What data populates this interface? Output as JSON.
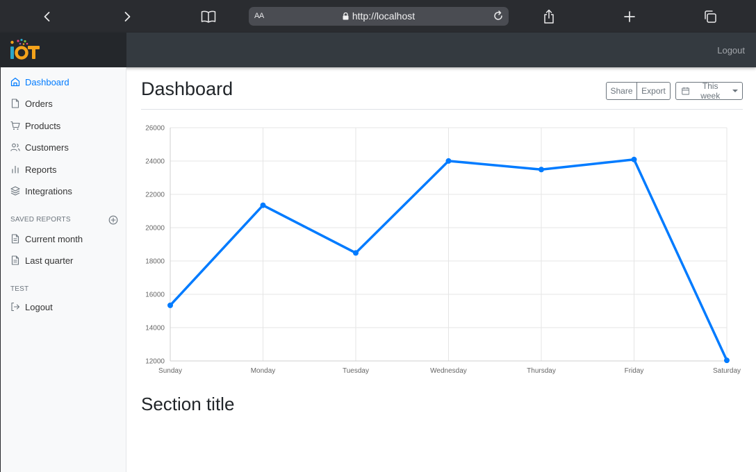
{
  "browser": {
    "address_text_size": "AA",
    "url": "http://localhost"
  },
  "navbar": {
    "brand": "IoT",
    "logout_label": "Logout"
  },
  "sidebar": {
    "items": [
      {
        "label": "Dashboard",
        "icon": "home-icon",
        "active": true
      },
      {
        "label": "Orders",
        "icon": "file-icon"
      },
      {
        "label": "Products",
        "icon": "shopping-cart-icon"
      },
      {
        "label": "Customers",
        "icon": "users-icon"
      },
      {
        "label": "Reports",
        "icon": "bar-chart-icon"
      },
      {
        "label": "Integrations",
        "icon": "layers-icon"
      }
    ],
    "saved_reports_heading": "Saved reports",
    "saved_reports": [
      {
        "label": "Current month",
        "icon": "file-text-icon"
      },
      {
        "label": "Last quarter",
        "icon": "file-text-icon"
      }
    ],
    "test_heading": "Test",
    "test_items": [
      {
        "label": "Logout",
        "icon": "log-out-icon"
      }
    ]
  },
  "main": {
    "title": "Dashboard",
    "share_label": "Share",
    "export_label": "Export",
    "period_label": "This week",
    "section_title": "Section title"
  },
  "colors": {
    "accent": "#007bff",
    "navbar": "#343a40",
    "sidebar": "#f8f9fa"
  },
  "chart_data": {
    "type": "line",
    "categories": [
      "Sunday",
      "Monday",
      "Tuesday",
      "Wednesday",
      "Thursday",
      "Friday",
      "Saturday"
    ],
    "values": [
      15339,
      21345,
      18483,
      24003,
      23489,
      24092,
      12034
    ],
    "ylim": [
      12000,
      26000
    ],
    "yticks": [
      12000,
      14000,
      16000,
      18000,
      20000,
      22000,
      24000,
      26000
    ],
    "grid": true,
    "line_color": "#007bff"
  }
}
